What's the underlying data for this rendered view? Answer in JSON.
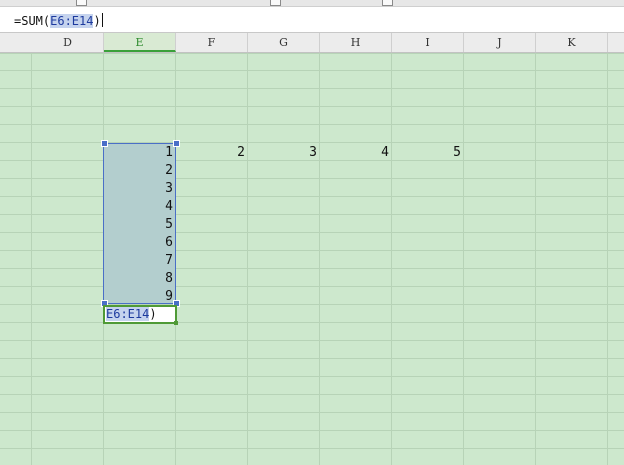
{
  "formula_bar": {
    "prefix": "=SUM(",
    "range_ref": "E6:E14",
    "suffix": ")"
  },
  "columns": [
    "D",
    "E",
    "F",
    "G",
    "H",
    "I",
    "J",
    "K"
  ],
  "active_column": "E",
  "cells": {
    "row6": [
      {
        "col": "E",
        "value": "1"
      },
      {
        "col": "F",
        "value": "2"
      },
      {
        "col": "G",
        "value": "3"
      },
      {
        "col": "H",
        "value": "4"
      },
      {
        "col": "I",
        "value": "5"
      }
    ],
    "column_e": [
      "2",
      "3",
      "4",
      "5",
      "6",
      "7",
      "8",
      "9"
    ]
  },
  "editing_cell": {
    "range_ref": "E6:E14",
    "suffix": ")"
  },
  "colors": {
    "sheet_background": "#cde8cd",
    "selection_fill": "#b3cece",
    "selection_border": "#4a6fc7",
    "edit_border": "#4f9a36",
    "active_header": "#2e8b2e"
  }
}
